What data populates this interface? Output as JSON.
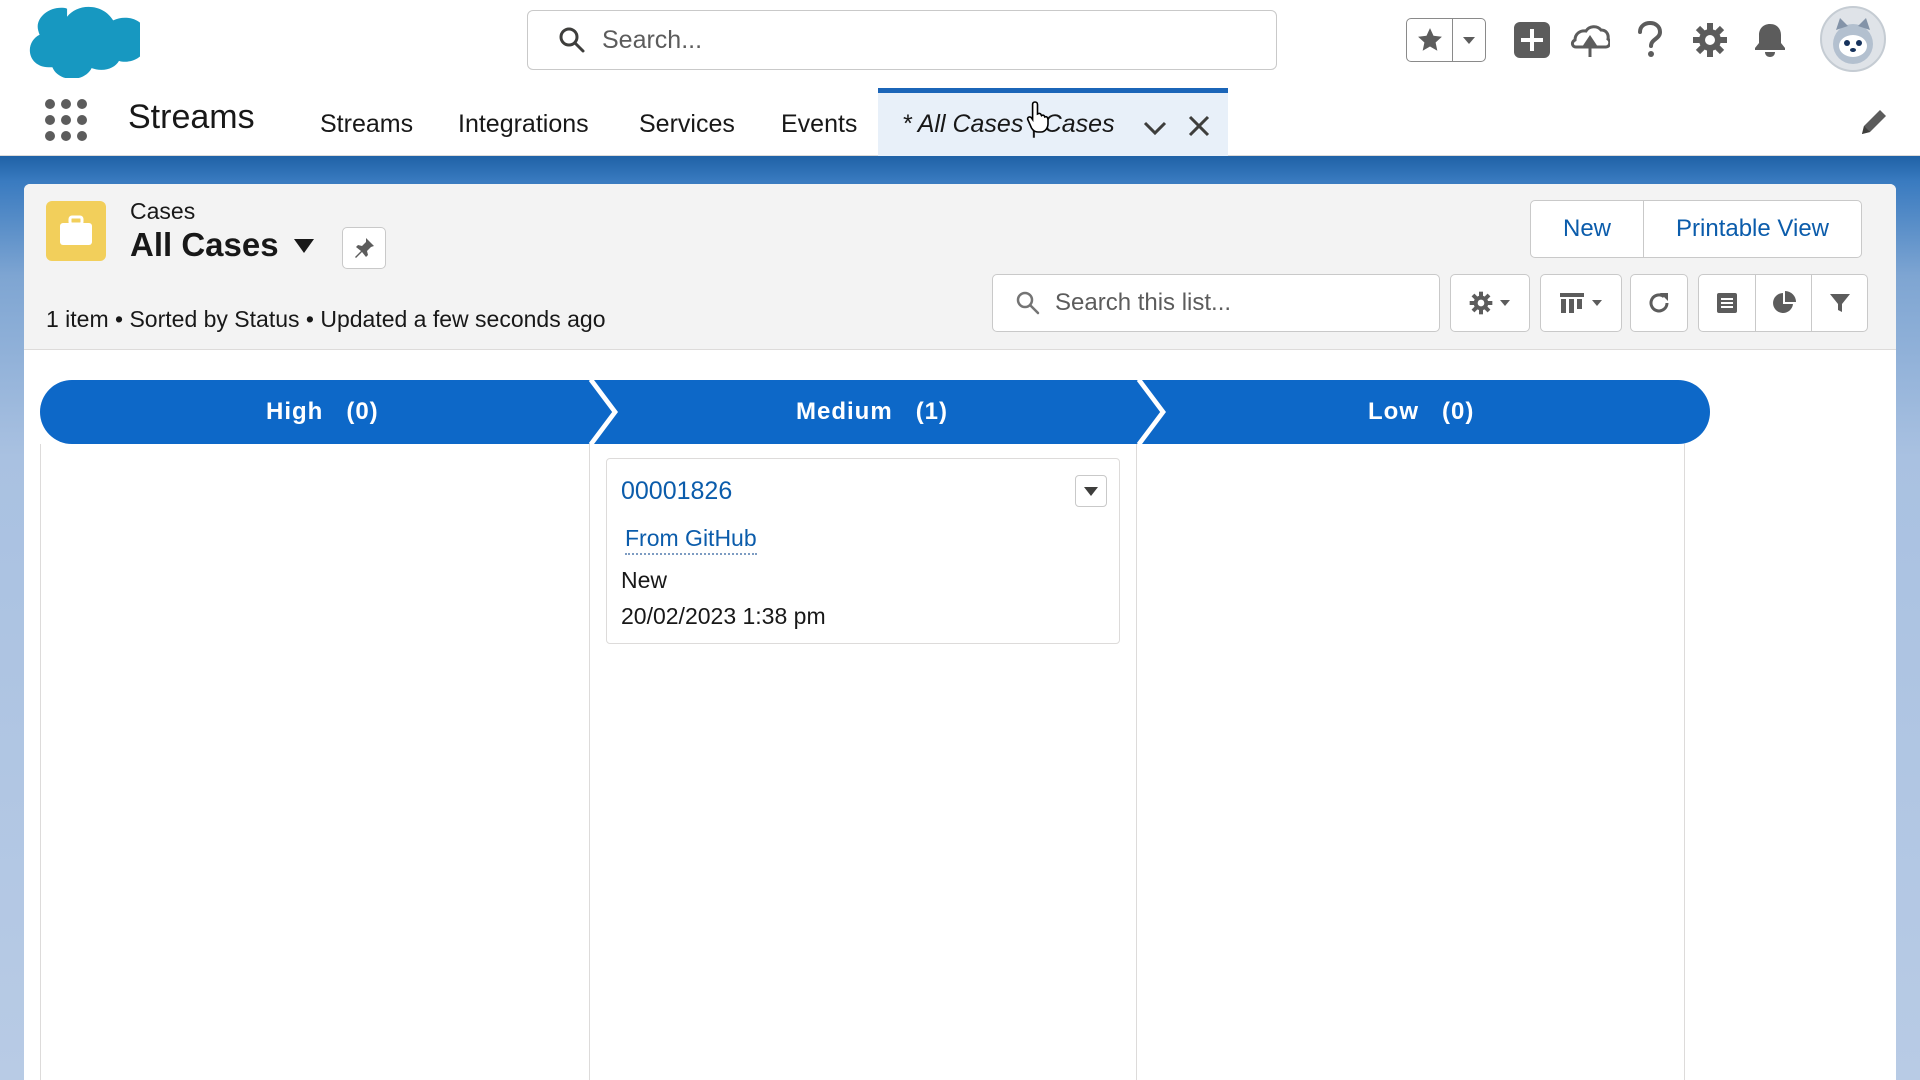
{
  "header": {
    "search_placeholder": "Search...",
    "icons": [
      "salesforce-cloud-logo",
      "search-icon",
      "star-icon",
      "chevron-down-icon",
      "plus-icon",
      "trailhead-icon",
      "help-icon",
      "gear-icon",
      "bell-icon",
      "avatar"
    ]
  },
  "nav": {
    "app_name": "Streams",
    "items": [
      {
        "label": "Streams"
      },
      {
        "label": "Integrations"
      },
      {
        "label": "Services"
      },
      {
        "label": "Events"
      }
    ],
    "active_tab": {
      "label": "* All Cases | Cases"
    }
  },
  "list": {
    "object_name": "Cases",
    "view_name": "All Cases",
    "info": "1 item • Sorted by Status • Updated a few seconds ago",
    "buttons": {
      "new": "New",
      "printable": "Printable View"
    },
    "search_placeholder": "Search this list..."
  },
  "kanban": {
    "columns": [
      {
        "label": "High",
        "count": "(0)"
      },
      {
        "label": "Medium",
        "count": "(1)"
      },
      {
        "label": "Low",
        "count": "(0)"
      }
    ],
    "cards": [
      {
        "case_number": "00001826",
        "subject": "From GitHub",
        "status": "New",
        "date": "20/02/2023 1:38 pm"
      }
    ]
  },
  "colors": {
    "brand_blue": "#0b5cab",
    "path_blue": "#0d68c8",
    "header_blue": "#1f62a6",
    "case_icon_yellow": "#f2cf5b"
  }
}
